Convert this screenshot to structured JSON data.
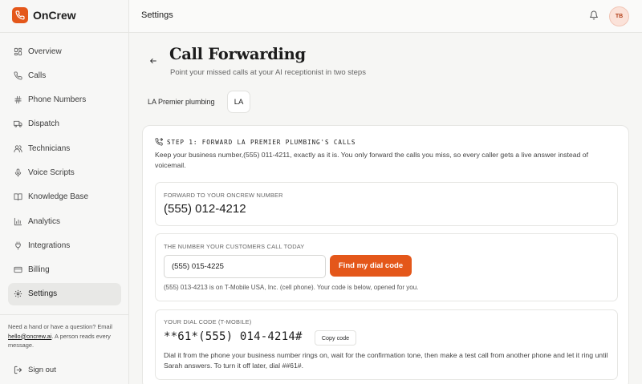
{
  "app": {
    "name": "OnCrew",
    "accent": "#e4571a"
  },
  "sidebar": {
    "items": [
      {
        "label": "Overview",
        "icon": "grid-icon"
      },
      {
        "label": "Calls",
        "icon": "phone-icon"
      },
      {
        "label": "Phone Numbers",
        "icon": "hash-icon"
      },
      {
        "label": "Dispatch",
        "icon": "truck-icon"
      },
      {
        "label": "Technicians",
        "icon": "users-icon"
      },
      {
        "label": "Voice Scripts",
        "icon": "mic-icon"
      },
      {
        "label": "Knowledge Base",
        "icon": "book-icon"
      },
      {
        "label": "Analytics",
        "icon": "chart-icon"
      },
      {
        "label": "Integrations",
        "icon": "plug-icon"
      },
      {
        "label": "Billing",
        "icon": "card-icon"
      },
      {
        "label": "Settings",
        "icon": "gear-icon",
        "active": true
      }
    ],
    "help_prefix": "Need a hand or have a question? Email ",
    "help_email": "hello@oncrew.ai",
    "help_suffix": ". A person reads every message.",
    "signout_label": "Sign out"
  },
  "header": {
    "title": "Settings",
    "avatar_initials": "TB"
  },
  "page": {
    "title": "Call Forwarding",
    "subtitle": "Point your missed calls at your AI receptionist in two steps"
  },
  "business": {
    "name": "LA Premier plumbing",
    "chip": "LA"
  },
  "step": {
    "title": "STEP 1: FORWARD LA PREMIER PLUMBING'S CALLS",
    "description": "Keep your business number,(555) 011-4211, exactly as it is. You only forward the calls you miss, so every caller gets a live answer instead of voicemail."
  },
  "forward": {
    "label": "FORWARD TO YOUR ONCREW NUMBER",
    "number": "(555) 012-4212"
  },
  "customer_number": {
    "label": "THE NUMBER YOUR CUSTOMERS CALL TODAY",
    "value": "(555) 015-4225",
    "button_label": "Find my dial code",
    "note": "(555) 013-4213 is on T-Mobile USA, Inc. (cell phone). Your code is below, opened for you."
  },
  "dial_code": {
    "label": "YOUR DIAL CODE (T-MOBILE)",
    "code": "**61*(555) 014-4214#",
    "copy_label": "Copy code",
    "instructions": "Dial it from the phone your business number rings on, wait for the confirmation tone, then make a test call from another phone and let it ring until Sarah answers. To turn it off later, dial ##61#."
  }
}
